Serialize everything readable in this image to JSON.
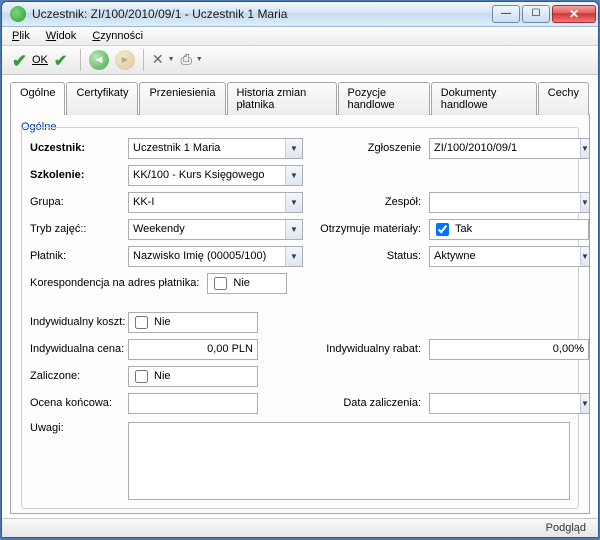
{
  "window": {
    "title": "Uczestnik: ZI/100/2010/09/1 - Uczestnik 1 Maria"
  },
  "menu": {
    "plik": "Plik",
    "widok": "Widok",
    "czynnosci": "Czynności"
  },
  "toolbar": {
    "ok": "OK"
  },
  "tabs": {
    "ogolne": "Ogólne",
    "certyfikaty": "Certyfikaty",
    "przeniesienia": "Przeniesienia",
    "historia": "Historia zmian płatnika",
    "pozycje": "Pozycje handlowe",
    "dokumenty": "Dokumenty handlowe",
    "cechy": "Cechy"
  },
  "section": {
    "ogolne": "Ogólne"
  },
  "labels": {
    "uczestnik": "Uczestnik:",
    "zgloszenie": "Zgłoszenie",
    "szkolenie": "Szkolenie:",
    "grupa": "Grupa:",
    "zespol": "Zespół:",
    "tryb": "Tryb zajęć::",
    "materialy": "Otrzymuje materiały:",
    "platnik": "Płatnik:",
    "status": "Status:",
    "koresp": "Korespondencja na adres płatnika:",
    "ind_koszt": "Indywidualny koszt:",
    "ind_cena": "Indywidualna cena:",
    "ind_rabat": "Indywidualny rabat:",
    "zaliczone": "Zaliczone:",
    "ocena": "Ocena końcowa:",
    "data_zal": "Data zaliczenia:",
    "uwagi": "Uwagi:"
  },
  "values": {
    "uczestnik": "Uczestnik 1 Maria",
    "zgloszenie": "ZI/100/2010/09/1",
    "szkolenie": "KK/100 - Kurs Księgowego",
    "grupa": "KK-I",
    "zespol": "",
    "tryb": "Weekendy",
    "materialy_txt": "Tak",
    "platnik": "Nazwisko Imię (00005/100)",
    "status": "Aktywne",
    "koresp_txt": "Nie",
    "ind_koszt_txt": "Nie",
    "ind_cena": "0,00 PLN",
    "ind_rabat": "0,00%",
    "zaliczone_txt": "Nie",
    "ocena": "",
    "data_zal": "",
    "uwagi": ""
  },
  "status_bar": "Podgląd"
}
